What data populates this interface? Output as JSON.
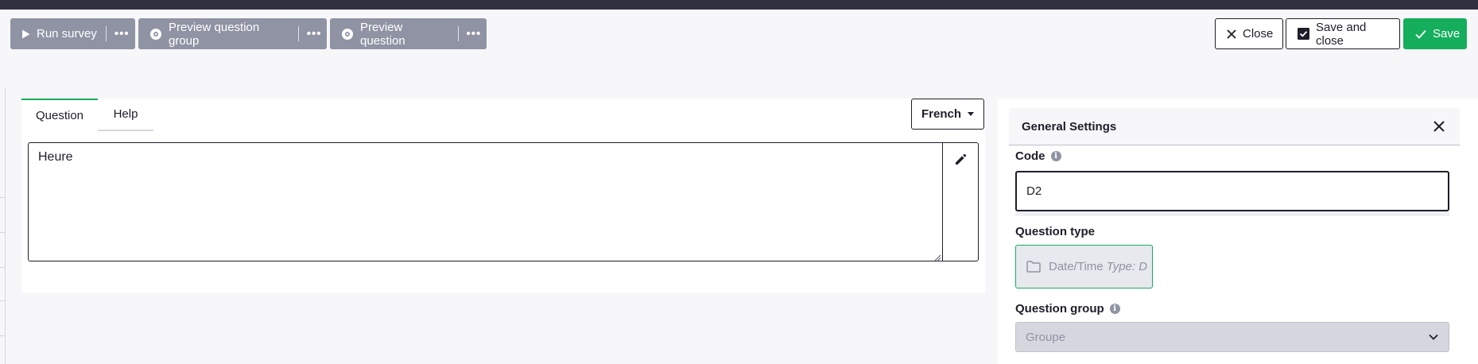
{
  "toolbar": {
    "run_survey": "Run survey",
    "preview_group": "Preview question group",
    "preview_question": "Preview question",
    "more": "•••",
    "close": "Close",
    "save_and_close": "Save and close",
    "save": "Save"
  },
  "editor": {
    "tabs": [
      "Question",
      "Help"
    ],
    "active_tab": "Question",
    "language": "French",
    "question_text": "Heure"
  },
  "settings": {
    "title": "General Settings",
    "code_label": "Code",
    "code_value": "D2",
    "question_type_label": "Question type",
    "question_type_name": "Date/Time",
    "question_type_code": "Type: D",
    "question_group_label": "Question group",
    "question_group_value": "Groupe"
  },
  "colors": {
    "accent": "#14ae5c",
    "toolbar_gray": "#8f93a3",
    "dark": "#1e1e2a",
    "topbar": "#2f3140"
  }
}
